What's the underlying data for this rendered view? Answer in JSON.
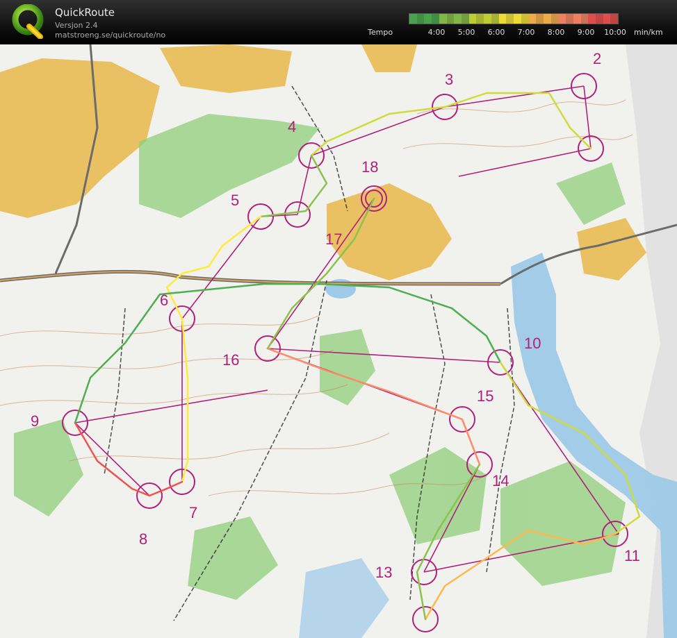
{
  "header": {
    "title": "QuickRoute",
    "version": "Versjon 2.4",
    "url": "matstroeng.se/quickroute/no",
    "tempo_label": "Tempo",
    "unit": "min/km",
    "ticks": [
      "4:00",
      "5:00",
      "6:00",
      "7:00",
      "8:00",
      "9:00",
      "10:00"
    ],
    "scale_colors": [
      "#4caf50",
      "#8bc34a",
      "#cddc39",
      "#ffeb3b",
      "#ffb74d",
      "#ff8a65",
      "#ef5350"
    ]
  },
  "map": {
    "control_numbers": [
      "2",
      "3",
      "4",
      "5",
      "6",
      "7",
      "8",
      "9",
      "10",
      "11",
      "13",
      "14",
      "15",
      "16",
      "17",
      "18"
    ],
    "colors": {
      "course": "#b0207a",
      "lake": "#9ec9e8",
      "open_land": "#e8b84a",
      "forest_green": "#9fd08a",
      "paper_white": "#f1f1ee"
    }
  }
}
